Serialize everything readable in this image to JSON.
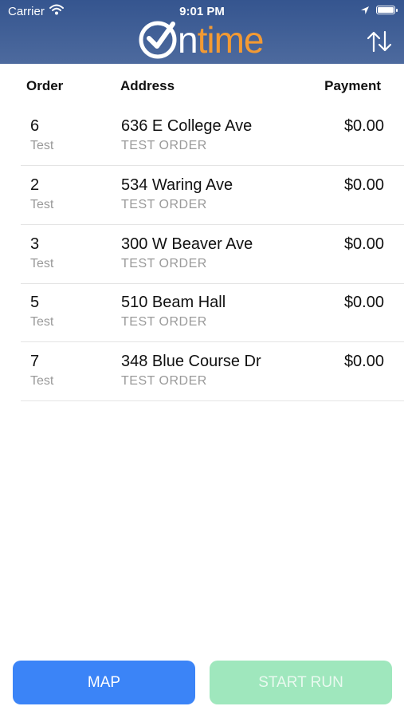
{
  "status_bar": {
    "carrier": "Carrier",
    "time": "9:01 PM",
    "wifi_icon": "wifi-icon",
    "location_icon": "location-arrow-icon",
    "battery_icon": "battery-icon"
  },
  "header": {
    "logo_o": "O",
    "logo_n": "n",
    "logo_time": "time",
    "sort_icon": "sort-arrows-icon",
    "colors": {
      "background": "#3d5b93",
      "logo_accent": "#f39a33"
    }
  },
  "table": {
    "columns": [
      "Order",
      "Address",
      "Payment"
    ],
    "rows": [
      {
        "order": "6",
        "customer": "Test",
        "address": "636 E College Ave",
        "note": "TEST ORDER",
        "payment": "$0.00"
      },
      {
        "order": "2",
        "customer": "Test",
        "address": "534 Waring Ave",
        "note": "TEST ORDER",
        "payment": "$0.00"
      },
      {
        "order": "3",
        "customer": "Test",
        "address": "300 W Beaver Ave",
        "note": "TEST ORDER",
        "payment": "$0.00"
      },
      {
        "order": "5",
        "customer": "Test",
        "address": "510 Beam Hall",
        "note": "TEST ORDER",
        "payment": "$0.00"
      },
      {
        "order": "7",
        "customer": "Test",
        "address": "348 Blue Course Dr",
        "note": "TEST ORDER",
        "payment": "$0.00"
      }
    ]
  },
  "buttons": {
    "map": "MAP",
    "start_run": "START RUN",
    "colors": {
      "map": "#3b84f7",
      "start_run": "#9fe7bd"
    }
  }
}
